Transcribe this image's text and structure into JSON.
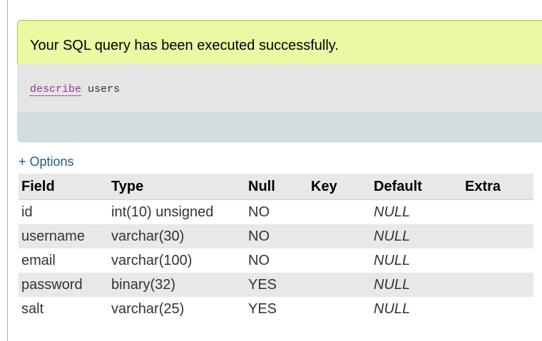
{
  "message": {
    "success_text": "Your SQL query has been executed successfully."
  },
  "query": {
    "keyword": "describe",
    "rest": " users"
  },
  "options_link": "+ Options",
  "table": {
    "headers": [
      "Field",
      "Type",
      "Null",
      "Key",
      "Default",
      "Extra"
    ],
    "rows": [
      [
        "id",
        "int(10) unsigned",
        "NO",
        "",
        "NULL",
        ""
      ],
      [
        "username",
        "varchar(30)",
        "NO",
        "",
        "NULL",
        ""
      ],
      [
        "email",
        "varchar(100)",
        "NO",
        "",
        "NULL",
        ""
      ],
      [
        "password",
        "binary(32)",
        "YES",
        "",
        "NULL",
        ""
      ],
      [
        "salt",
        "varchar(25)",
        "YES",
        "",
        "NULL",
        ""
      ]
    ]
  }
}
